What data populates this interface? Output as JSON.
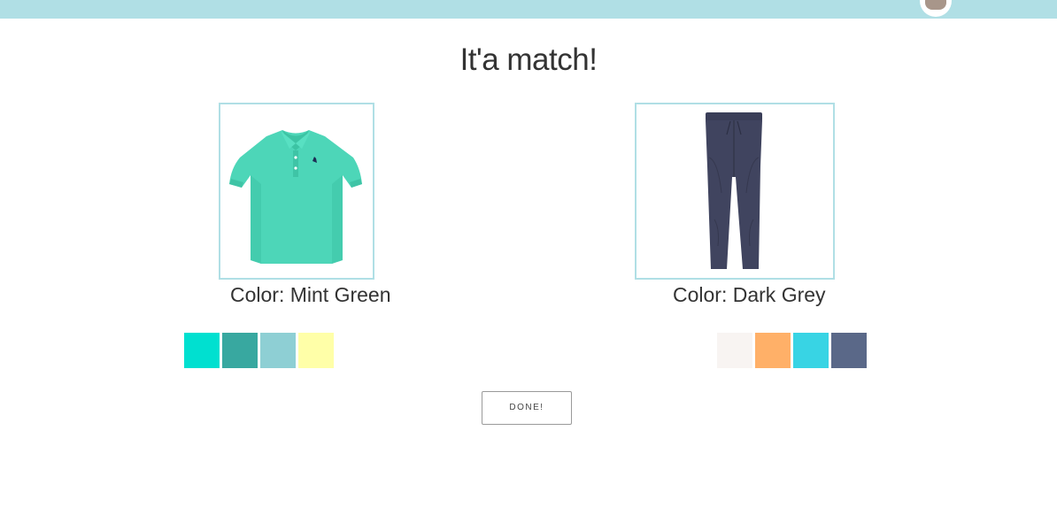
{
  "header": {
    "avatar_icon": "cat-avatar-icon",
    "bar_color": "#b0dfe5"
  },
  "page": {
    "title": "It'a match!"
  },
  "items": [
    {
      "name": "top",
      "icon": "polo-shirt-image",
      "color_label": "Color: Mint Green",
      "palette": [
        "#00e0d0",
        "#38a8a0",
        "#8ecfd4",
        "#ffffa8"
      ]
    },
    {
      "name": "bottom",
      "icon": "pants-image",
      "color_label": "Color: Dark Grey",
      "palette": [
        "#f8f4f2",
        "#ffb068",
        "#38d4e4",
        "#5a6888"
      ]
    }
  ],
  "actions": {
    "done_label": "DONE!"
  }
}
